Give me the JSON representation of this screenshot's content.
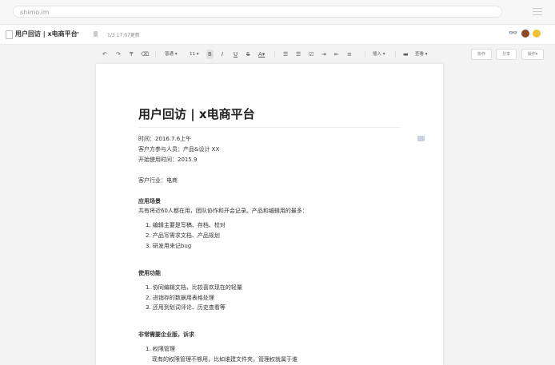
{
  "browser": {
    "url": "shimo.im"
  },
  "titlebar": {
    "doc_title": "用户回访 | x电商平台",
    "caret": "▾",
    "updated": "1/3 17:07更新"
  },
  "toolbar": {
    "undo": "↶",
    "redo": "↷",
    "format_paint": "₸",
    "clear": "⌫",
    "style": "普通 ▾",
    "size": "11 ▾",
    "bold": "B",
    "italic": "I",
    "underline": "U",
    "strike": "S",
    "color": "A▾",
    "insert": "插入 ▾",
    "view": "查看 ▾",
    "btn_collab": "协作",
    "btn_share": "分享",
    "btn_ops": "操作▾"
  },
  "doc": {
    "title": "用户回访 | x电商平台",
    "time": "时间：2016.7.6上午",
    "participants": "客户方参与人员：产品&设计 XX",
    "start": "开始使用时间：2015.9",
    "industry": "客户行业：电商",
    "scenario_h": "应用场景",
    "scenario_p": "共有将近60人都在用，团队协作和开会记录。产品和编辑用的最多：",
    "scenario_1": "1. 编辑主要是写稿、存档、校对",
    "scenario_2": "2. 产品写需求文档、产品规划",
    "scenario_3": "3. 研发用来记bug",
    "features_h": "使用功能",
    "features_1": "1. 协同编辑文档，比较喜欢现在的轻量",
    "features_2": "2. 进销存的数据用表格处理",
    "features_3": "3. 还用到划词评论、历史查看等",
    "enterprise_h": "非常需要企业版，诉求",
    "enterprise_1": "1. 权限管理",
    "enterprise_1_sub": "现有的权限管理不够用，比如谁建文件夹，管理权就属于谁"
  }
}
